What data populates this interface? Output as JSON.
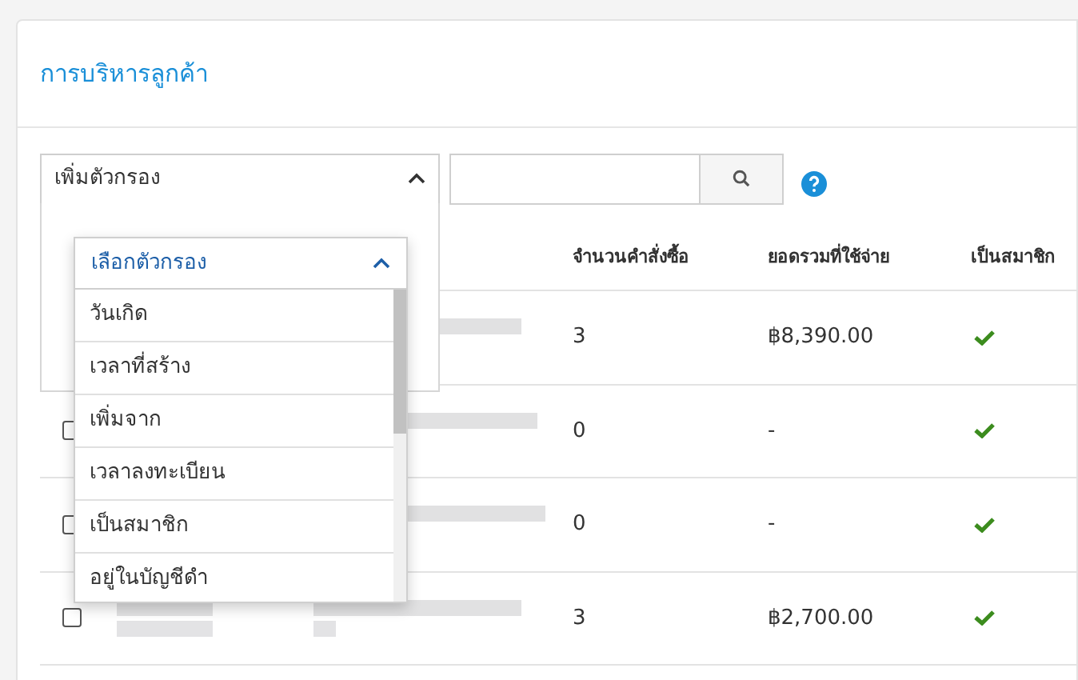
{
  "title": "การบริหารลูกค้า",
  "filter_button": {
    "label": "เพิ่มตัวกรอง",
    "expanded": true
  },
  "filter_panel": {
    "select_label": "เลือกตัวกรอง",
    "options": [
      "วันเกิด",
      "เวลาที่สร้าง",
      "เพิ่มจาก",
      "เวลาลงทะเบียน",
      "เป็นสมาชิก",
      "อยู่ในบัญชีดำ"
    ]
  },
  "table": {
    "columns": [
      "จำนวนคำสั่งซื้อ",
      "ยอดรวมที่ใช้จ่าย",
      "เป็นสมาชิก"
    ],
    "rows": [
      {
        "orders": "3",
        "total": "฿8,390.00",
        "member": true
      },
      {
        "orders": "0",
        "total": "-",
        "member": true,
        "checked": false
      },
      {
        "orders": "0",
        "total": "-",
        "member": true,
        "checked": false
      },
      {
        "orders": "3",
        "total": "฿2,700.00",
        "member": true,
        "checked": false
      }
    ]
  }
}
